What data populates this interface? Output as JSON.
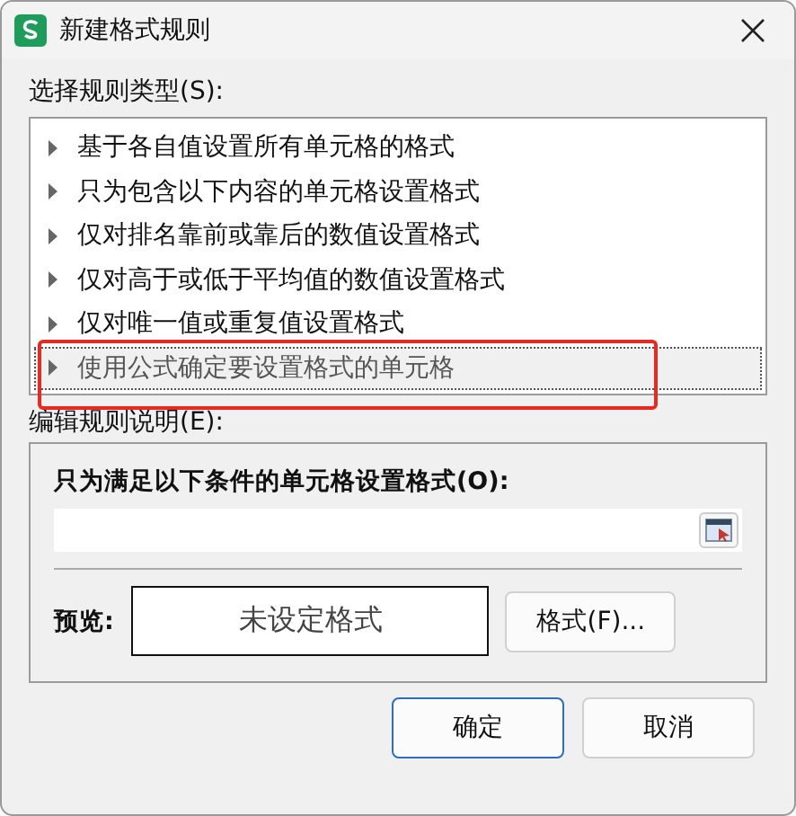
{
  "window": {
    "title": "新建格式规则"
  },
  "rule_type": {
    "label": "选择规则类型(S):",
    "items": [
      {
        "label": "基于各自值设置所有单元格的格式",
        "selected": false
      },
      {
        "label": "只为包含以下内容的单元格设置格式",
        "selected": false
      },
      {
        "label": "仅对排名靠前或靠后的数值设置格式",
        "selected": false
      },
      {
        "label": "仅对高于或低于平均值的数值设置格式",
        "selected": false
      },
      {
        "label": "仅对唯一值或重复值设置格式",
        "selected": false
      },
      {
        "label": "使用公式确定要设置格式的单元格",
        "selected": true
      }
    ]
  },
  "description": {
    "label": "编辑规则说明(E):",
    "condition_label": "只为满足以下条件的单元格设置格式(O):",
    "preview_label": "预览:",
    "preview_text": "未设定格式",
    "format_button": "格式(F)..."
  },
  "buttons": [
    {
      "label": "确定",
      "default": true
    },
    {
      "label": "取消",
      "default": false
    }
  ]
}
